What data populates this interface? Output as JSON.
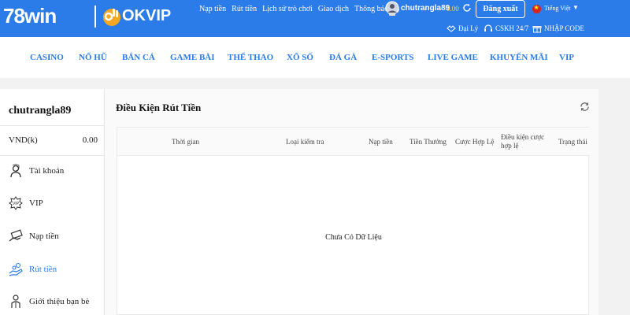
{
  "header": {
    "logo_78win": "78win",
    "logo_okvip": "OKVIP",
    "nav": [
      "Nạp tiền",
      "Rút tiền",
      "Lịch sử trò chơi",
      "Giao dịch",
      "Thông báo (0)"
    ],
    "username": "chutrangla89",
    "balance": "0.00",
    "logout_label": "Đăng xuất",
    "language": "Tiếng Việt",
    "agent_label": "Đại Lý",
    "support_label": "CSKH 24/7",
    "code_label": "NHẬP CODE",
    "colors": {
      "bar": "#2b7be9",
      "balance": "#ffd84a"
    }
  },
  "mainnav": [
    "CASINO",
    "NỔ HŨ",
    "BẮN CÁ",
    "GAME BÀI",
    "THỂ THAO",
    "XỔ SỐ",
    "ĐÁ GÀ",
    "E-SPORTS",
    "LIVE GAME",
    "KHUYẾN MÃI",
    "VIP"
  ],
  "sidebar": {
    "username": "chutrangla89",
    "currency": "VND(k)",
    "balance": "0.00",
    "items": [
      {
        "label": "Tài khoản",
        "icon": "user-icon"
      },
      {
        "label": "VIP",
        "icon": "vip-badge-icon"
      },
      {
        "label": "Nạp tiền",
        "icon": "deposit-icon"
      },
      {
        "label": "Rút tiền",
        "icon": "withdraw-icon"
      },
      {
        "label": "Giới thiệu bạn bè",
        "icon": "referral-icon"
      }
    ]
  },
  "panel": {
    "title": "Điều Kiện Rút Tiền",
    "columns": [
      "Thời gian",
      "Loại kiểm tra",
      "Nạp tiền",
      "Tiền Thưởng",
      "Cược Hợp Lệ",
      "Điều kiện cược hợp lệ",
      "Trạng thái"
    ],
    "empty_text": "Chưa Có Dữ Liệu"
  }
}
